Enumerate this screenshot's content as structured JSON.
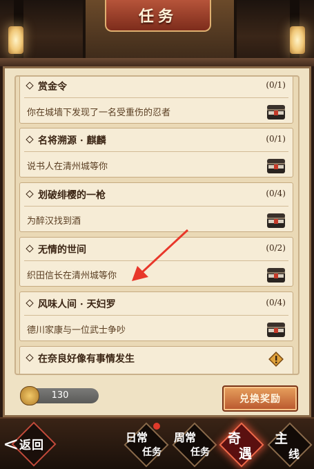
{
  "header": {
    "title": "任务"
  },
  "quests": [
    {
      "title": "赏金令",
      "progress": "(0/1)",
      "desc": "你在城墙下发现了一名受重伤的忍者",
      "icon": "chest-icon"
    },
    {
      "title": "名将溯源 · 麒麟",
      "progress": "(0/1)",
      "desc": "说书人在清州城等你",
      "icon": "chest-icon"
    },
    {
      "title": "划破绯樱的一枪",
      "progress": "(0/4)",
      "desc": "为醉汉找到酒",
      "icon": "chest-icon"
    },
    {
      "title": "无情的世间",
      "progress": "(0/2)",
      "desc": "织田信长在清州城等你",
      "icon": "chest-icon"
    },
    {
      "title": "风味人间 · 天妇罗",
      "progress": "(0/4)",
      "desc": "德川家康与一位武士争吵",
      "icon": "chest-icon"
    },
    {
      "title": "在奈良好像有事情发生",
      "progress": "",
      "desc": "",
      "icon": "warning-icon"
    }
  ],
  "currency": {
    "value": "130",
    "icon": "torii-coin-icon"
  },
  "exchange_button": "兑换奖励",
  "nav": {
    "back": "返回",
    "tabs": [
      {
        "line1": "日常",
        "line2": "任务",
        "active": false,
        "dot": true
      },
      {
        "line1": "周常",
        "line2": "任务",
        "active": false,
        "dot": false
      },
      {
        "line1": "奇",
        "line2": "遇",
        "active": true,
        "dot": false
      },
      {
        "line1": "主",
        "line2": "线",
        "active": false,
        "dot": false
      }
    ]
  },
  "colors": {
    "accent": "#b8562d",
    "panel": "#efe2c4",
    "alert_dot": "#e03a2a"
  }
}
